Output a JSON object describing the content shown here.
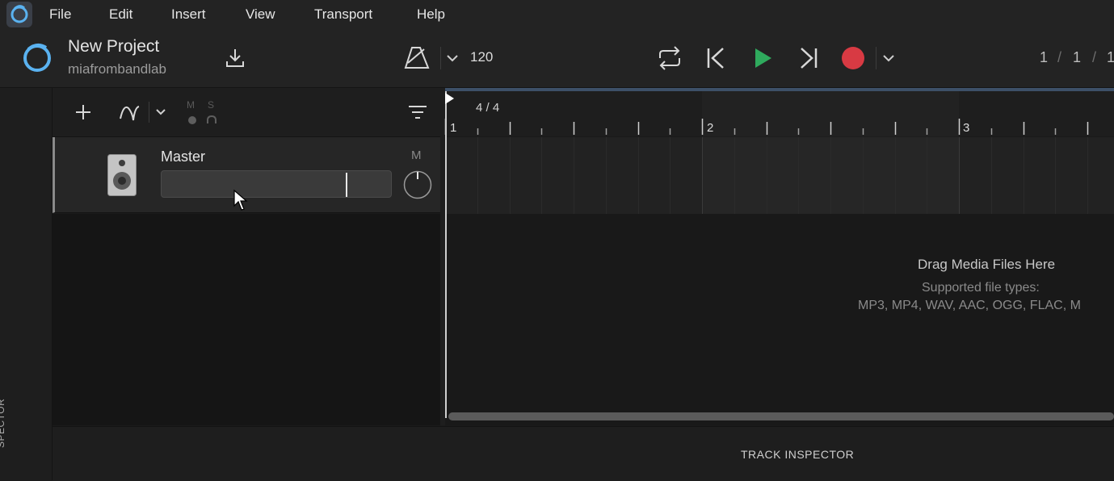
{
  "menu": [
    "File",
    "Edit",
    "Insert",
    "View",
    "Transport",
    "Help"
  ],
  "project": {
    "title": "New Project",
    "user": "miafrombandlab"
  },
  "transport": {
    "tempo": "120",
    "record_color": "#d83a43",
    "play_color": "#2faa5d"
  },
  "position": {
    "a": "1",
    "sep1": "/",
    "b": "1",
    "sep2": "/",
    "c": "1"
  },
  "toolbar": {
    "mute_letter": "M",
    "solo_letter": "S"
  },
  "master": {
    "name": "Master",
    "mute": "M",
    "volume_fraction": 0.81
  },
  "timeline": {
    "time_signature": "4 / 4",
    "bars": [
      "1",
      "2",
      "3"
    ],
    "drop_title": "Drag Media Files Here",
    "drop_subtitle": "Supported file types:",
    "drop_types": "MP3, MP4, WAV, AAC, OGG, FLAC, M"
  },
  "inspector": {
    "side_label": "SPECTOR",
    "bottom_label": "TRACK INSPECTOR"
  },
  "icons": {
    "app_logo": "bandlab-logo-icon",
    "save": "download-icon",
    "metronome": "metronome-icon",
    "loop": "loop-icon",
    "skip_back": "skip-back-icon",
    "play": "play-icon",
    "skip_forward": "skip-forward-icon",
    "record": "record-icon",
    "add": "plus-icon",
    "automation": "automation-icon",
    "filter": "filter-icon",
    "speaker": "speaker-icon",
    "knob": "pan-knob-icon"
  }
}
